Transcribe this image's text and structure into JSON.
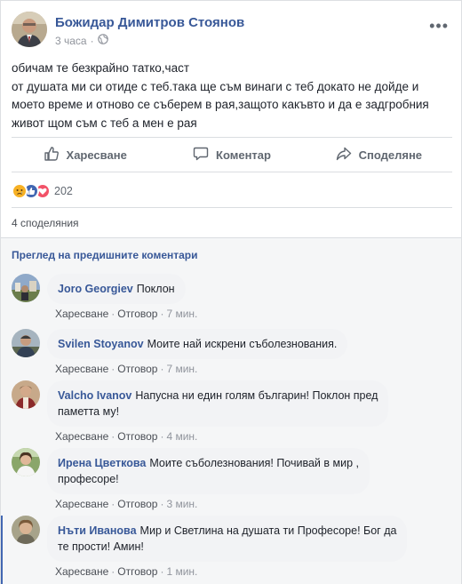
{
  "post": {
    "author": "Божидар Димитров Стоянов",
    "time": "3 часа",
    "privacy_icon": "globe-icon",
    "text_lines": [
      "обичам те безкрайно татко,част",
      "от душата ми си отиде с теб.така ще съм винаги с теб докато не дойде и",
      "моето време и отново се съберем в рая,защото какъвто и да е задгробния",
      "живот щом съм с теб а мен е рая"
    ]
  },
  "actions": {
    "like": "Харесване",
    "comment": "Коментар",
    "share": "Споделяне"
  },
  "reactions": {
    "icons": [
      "sad-icon",
      "like-icon",
      "love-icon"
    ],
    "count": "202"
  },
  "shares": "4 споделяния",
  "comments_section": {
    "view_previous": "Преглед на предишните коментари",
    "like_label": "Харесване",
    "reply_label": "Отговор",
    "separator": "·",
    "items": [
      {
        "name": "Joro Georgiev",
        "text": "Поклон",
        "time": "7 мин."
      },
      {
        "name": "Svilen Stoyanov",
        "text": "Моите най искрени съболезнования.",
        "time": "7 мин."
      },
      {
        "name": "Valcho Ivanov",
        "text_lines": [
          "Напусна ни един голям българин! Поклон пред",
          "паметта му!"
        ],
        "time": "4 мин."
      },
      {
        "name": "Ирена Цветкова",
        "text_lines": [
          "Моите съболезнования! Почивай в мир ,",
          "професоре!"
        ],
        "time": "3 мин."
      },
      {
        "name": "Нъти Иванова",
        "text_lines": [
          "Мир и Светлина на душата ти Професоре! Бог да",
          "те прости! Амин!"
        ],
        "time": "1 мин."
      }
    ]
  },
  "colors": {
    "link": "#385898",
    "like_blue": "#4267b2",
    "love_red": "#f25268",
    "sad_yellow": "#f7b125"
  }
}
